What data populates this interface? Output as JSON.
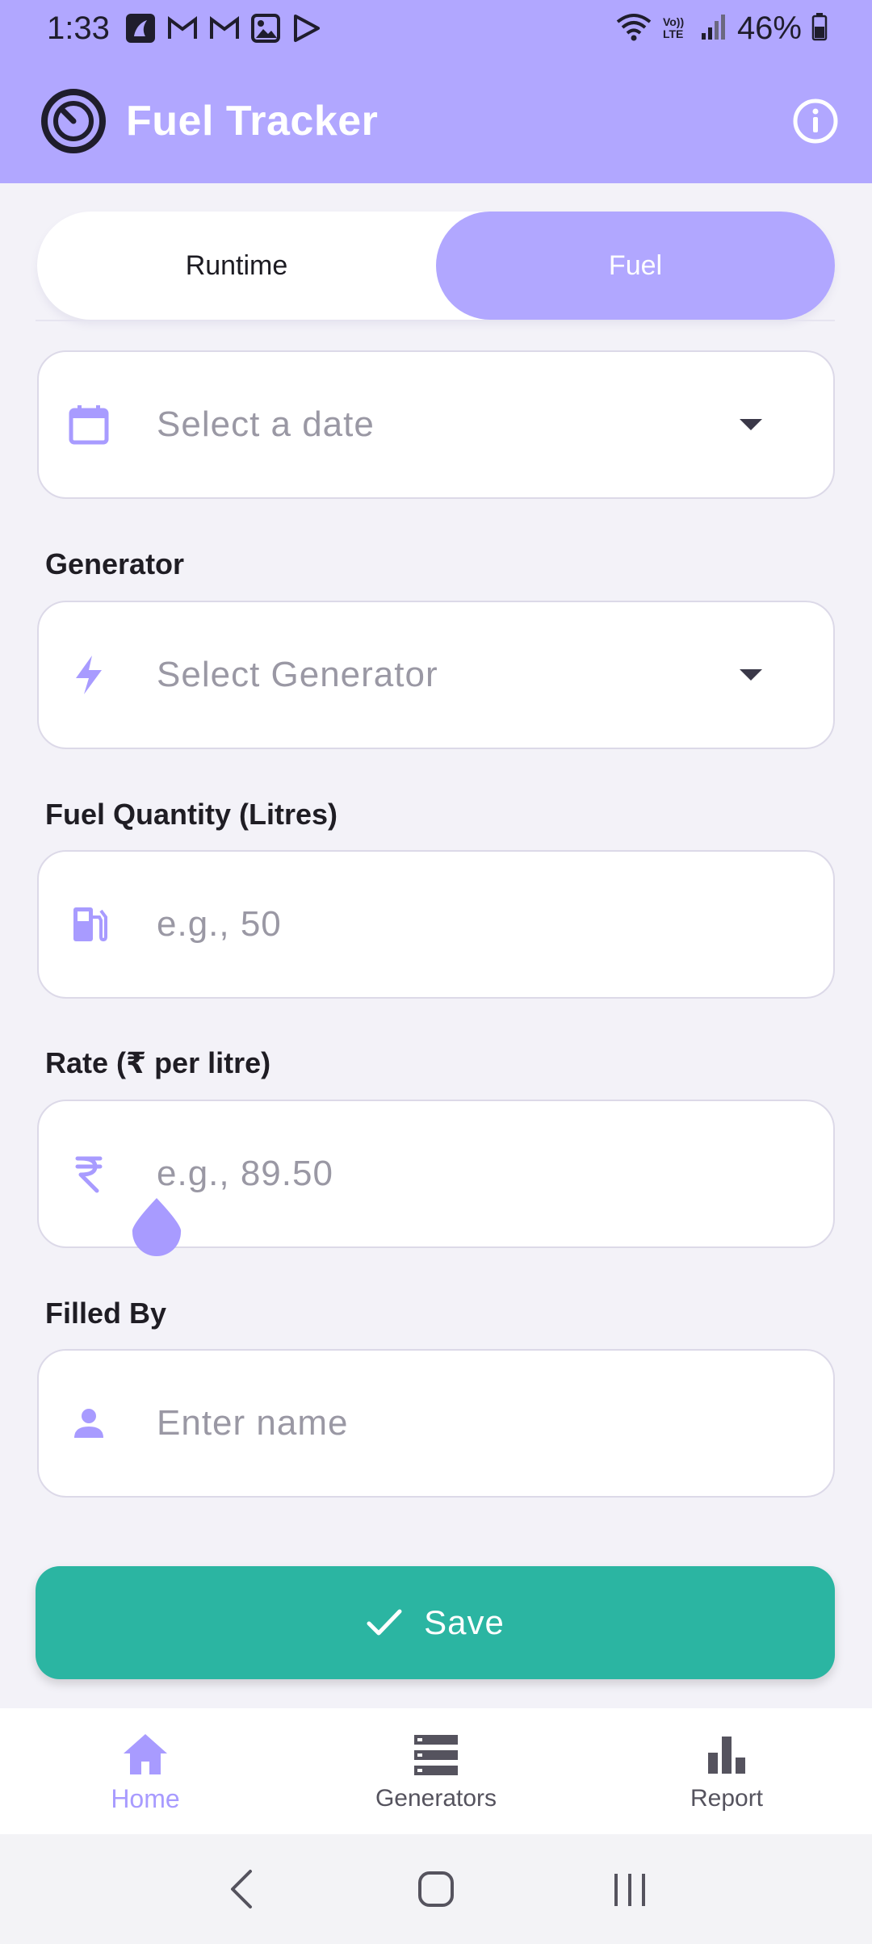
{
  "status_bar": {
    "time": "1:33",
    "battery": "46%",
    "network_label": "Vo)) LTE"
  },
  "app_bar": {
    "title": "Fuel Tracker",
    "accent_color": "#b1a7ff",
    "icons": [
      "gauge-logo-icon",
      "info-icon"
    ]
  },
  "tabs": [
    {
      "label": "Runtime",
      "selected": false
    },
    {
      "label": "Fuel",
      "selected": true
    }
  ],
  "form": {
    "date": {
      "placeholder": "Select a date",
      "value": "",
      "icon": "calendar-icon"
    },
    "generator": {
      "label": "Generator",
      "placeholder": "Select Generator",
      "value": "",
      "icon": "bolt-icon"
    },
    "fuel_quantity": {
      "label": "Fuel Quantity (Litres)",
      "placeholder": "e.g., 50",
      "value": "",
      "icon": "fuel-pump-icon"
    },
    "rate": {
      "label": "Rate (₹ per litre)",
      "placeholder": "e.g., 89.50",
      "value": "",
      "icon": "rupee-icon"
    },
    "filled_by": {
      "label": "Filled By",
      "placeholder": "Enter name",
      "value": "",
      "icon": "person-icon"
    }
  },
  "save_button": {
    "label": "Save",
    "color": "#2bb5a2"
  },
  "bottom_nav": [
    {
      "label": "Home",
      "icon": "home-icon",
      "active": true
    },
    {
      "label": "Generators",
      "icon": "list-icon",
      "active": false
    },
    {
      "label": "Report",
      "icon": "bar-chart-icon",
      "active": false
    }
  ]
}
